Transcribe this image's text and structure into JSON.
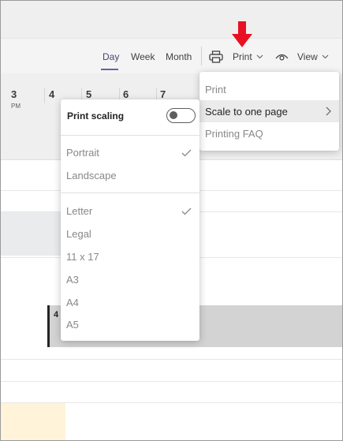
{
  "toolbar": {
    "tabs": [
      {
        "label": "Day",
        "active": true
      },
      {
        "label": "Week",
        "active": false
      },
      {
        "label": "Month",
        "active": false
      }
    ],
    "print_label": "Print",
    "view_label": "View",
    "accent_color": "#6264a7"
  },
  "annotation": {
    "color": "#e81123",
    "icon": "down-arrow-icon"
  },
  "timeline": {
    "hours": [
      "3",
      "4",
      "5",
      "6",
      "7"
    ],
    "period": "PM",
    "event_label": "4"
  },
  "print_menu": {
    "items": [
      {
        "label": "Print"
      },
      {
        "label": "Scale to one page",
        "highlighted": true,
        "has_submenu": true
      },
      {
        "label": "Printing FAQ"
      }
    ]
  },
  "scale_menu": {
    "title": "Print scaling",
    "toggle_on": false,
    "orientation": [
      {
        "label": "Portrait",
        "checked": true
      },
      {
        "label": "Landscape",
        "checked": false
      }
    ],
    "paper_sizes": [
      {
        "label": "Letter",
        "checked": true
      },
      {
        "label": "Legal",
        "checked": false
      },
      {
        "label": "11 x 17",
        "checked": false
      },
      {
        "label": "A3",
        "checked": false
      },
      {
        "label": "A4",
        "checked": false
      },
      {
        "label": "A5",
        "checked": false
      }
    ]
  }
}
